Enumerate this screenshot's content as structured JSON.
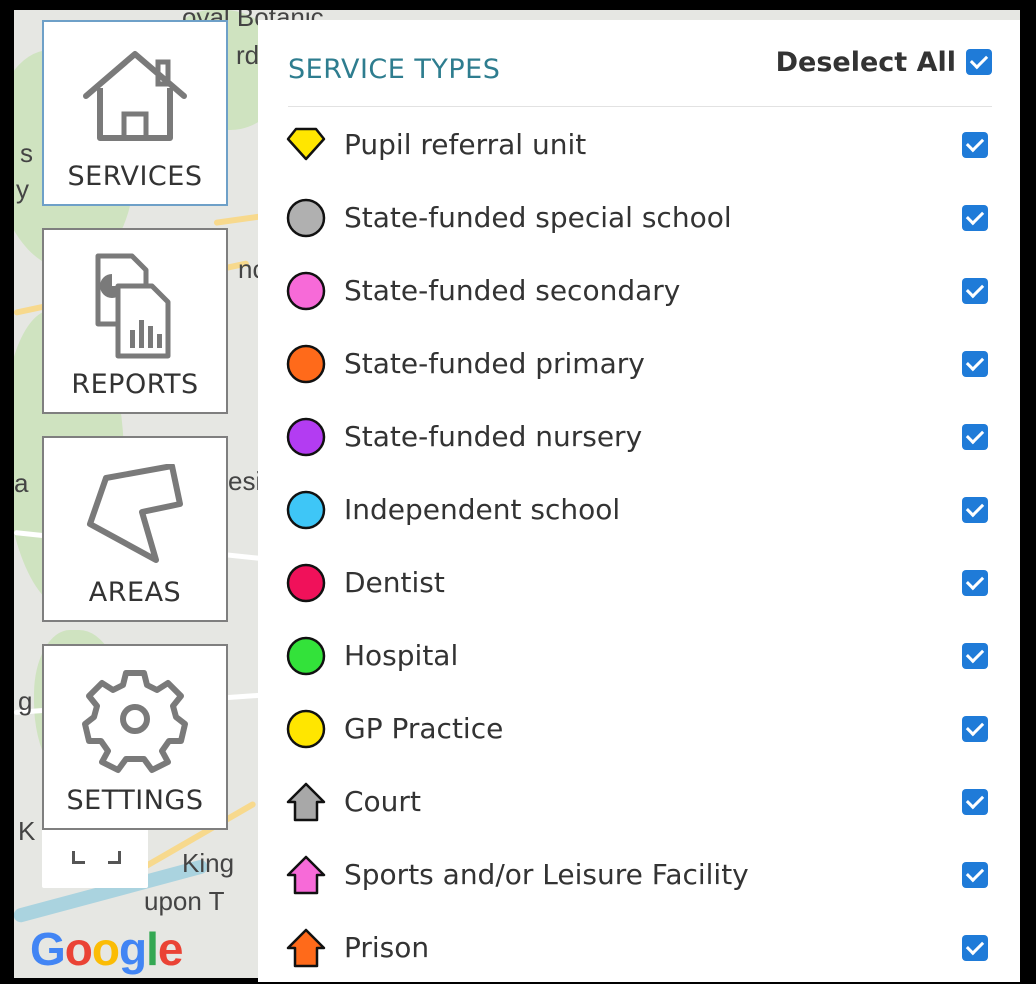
{
  "map": {
    "labels": [
      "oyal Botanic",
      "rd",
      "s",
      "y",
      "nc",
      "a",
      "esi",
      "g",
      "K",
      "King",
      "upon T"
    ]
  },
  "nav": {
    "services": "SERVICES",
    "reports": "REPORTS",
    "areas": "AREAS",
    "settings": "SETTINGS"
  },
  "panel": {
    "title": "SERVICE TYPES",
    "deselect_all": "Deselect All",
    "items": [
      {
        "label": "Pupil referral unit",
        "shape": "diamond",
        "color": "#ffe600"
      },
      {
        "label": "State-funded special school",
        "shape": "circle",
        "color": "#b0b0b0"
      },
      {
        "label": "State-funded secondary",
        "shape": "circle",
        "color": "#f76ad8"
      },
      {
        "label": "State-funded primary",
        "shape": "circle",
        "color": "#ff6a1a"
      },
      {
        "label": "State-funded nursery",
        "shape": "circle",
        "color": "#b33cf2"
      },
      {
        "label": "Independent school",
        "shape": "circle",
        "color": "#3ec6f7"
      },
      {
        "label": "Dentist",
        "shape": "circle",
        "color": "#f0115a"
      },
      {
        "label": "Hospital",
        "shape": "circle",
        "color": "#33e23a"
      },
      {
        "label": "GP Practice",
        "shape": "circle",
        "color": "#ffe600"
      },
      {
        "label": "Court",
        "shape": "house",
        "color": "#a8a8a8"
      },
      {
        "label": "Sports and/or Leisure Facility",
        "shape": "house",
        "color": "#f76ad8"
      },
      {
        "label": "Prison",
        "shape": "house",
        "color": "#ff6a1a"
      }
    ]
  },
  "google": {
    "letters": [
      "G",
      "o",
      "o",
      "g",
      "l",
      "e"
    ],
    "colors": [
      "#4285f4",
      "#ea4335",
      "#fbbc05",
      "#4285f4",
      "#34a853",
      "#ea4335"
    ]
  }
}
